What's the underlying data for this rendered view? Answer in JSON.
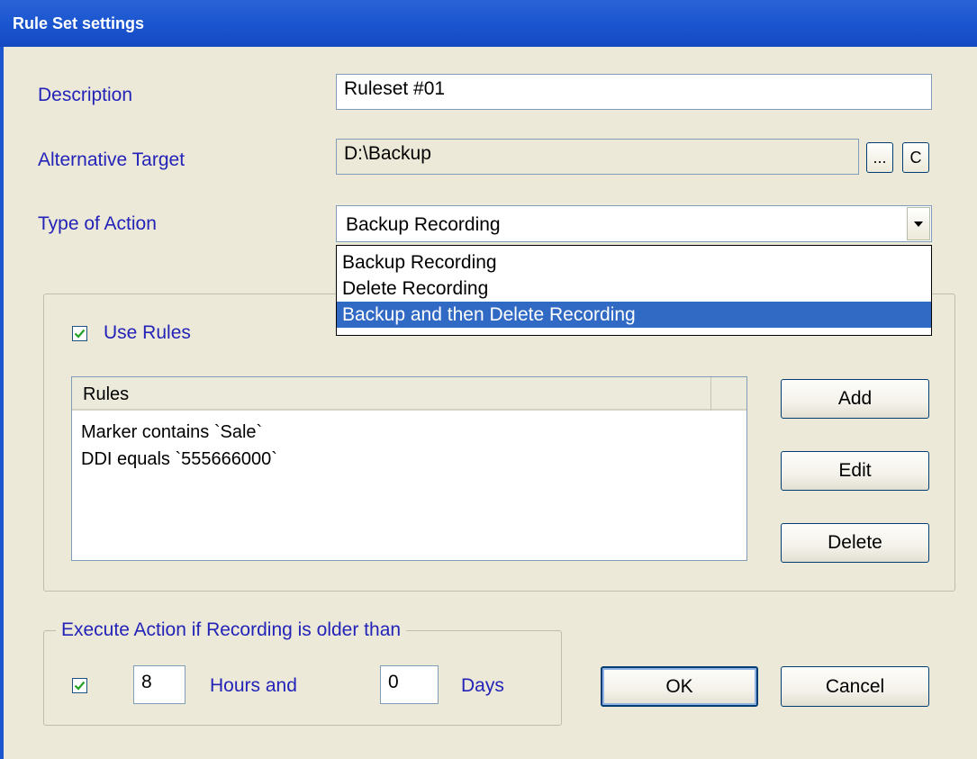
{
  "window": {
    "title": "Rule Set settings"
  },
  "fields": {
    "description_label": "Description",
    "description_value": "Ruleset #01",
    "alt_target_label": "Alternative Target",
    "alt_target_value": "D:\\Backup",
    "browse_label": "...",
    "clear_label": "C",
    "action_label": "Type of Action",
    "action_value": "Backup Recording"
  },
  "action_options": [
    "Backup Recording",
    "Delete Recording",
    "Backup and then Delete Recording"
  ],
  "action_selected_index": 2,
  "rules": {
    "use_rules_label": "Use Rules",
    "use_rules_checked": true,
    "column_header": "Rules",
    "items": [
      "Marker contains `Sale`",
      "DDI equals `555666000`"
    ],
    "add_label": "Add",
    "edit_label": "Edit",
    "delete_label": "Delete"
  },
  "execute": {
    "group_title": "Execute Action if Recording is older than",
    "enabled_checked": true,
    "hours_value": "8",
    "hours_label": "Hours and",
    "days_value": "0",
    "days_label": "Days"
  },
  "buttons": {
    "ok_label": "OK",
    "cancel_label": "Cancel"
  },
  "colors": {
    "title_bar": "#1b56d0",
    "label_blue": "#2323b8",
    "selection": "#316ac5",
    "dialog_bg": "#ece9d8"
  }
}
